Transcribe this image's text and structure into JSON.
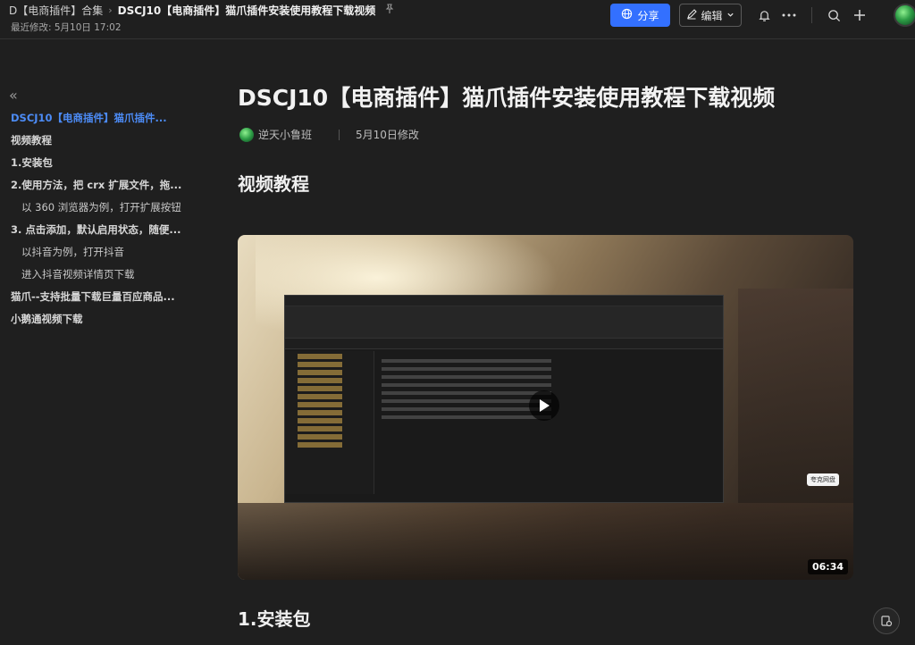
{
  "header": {
    "breadcrumb": [
      {
        "label": "D【电商插件】合集"
      },
      {
        "label": "DSCJ10【电商插件】猫爪插件安装使用教程下载视频"
      }
    ],
    "breadcrumb_separator": "›",
    "last_modified": "最近修改: 5月10日 17:02",
    "share_label": "分享",
    "edit_label": "编辑"
  },
  "sidebar": {
    "collapse_icon": "«",
    "toc": [
      {
        "label": "DSCJ10【电商插件】猫爪插件...",
        "level": 1,
        "active": true
      },
      {
        "label": "视频教程",
        "level": 1
      },
      {
        "label": "1.安装包",
        "level": 1
      },
      {
        "label": "2.使用方法，把 crx 扩展文件，拖...",
        "level": 1
      },
      {
        "label": "以 360 浏览器为例，打开扩展按钮",
        "level": 2
      },
      {
        "label": "3. 点击添加，默认启用状态，随便...",
        "level": 1
      },
      {
        "label": "以抖音为例，打开抖音",
        "level": 2
      },
      {
        "label": "进入抖音视频详情页下载",
        "level": 2
      },
      {
        "label": "猫爪--支持批量下载巨量百应商品...",
        "level": 1
      },
      {
        "label": "小鹅通视频下载",
        "level": 1
      }
    ]
  },
  "doc": {
    "title": "DSCJ10【电商插件】猫爪插件安装使用教程下载视频",
    "author": "逆天小鲁班",
    "modified": "5月10日修改",
    "section_video": "视频教程",
    "video_duration": "06:34",
    "video_badge": "夸克网盘",
    "section_install": "1.安装包"
  }
}
